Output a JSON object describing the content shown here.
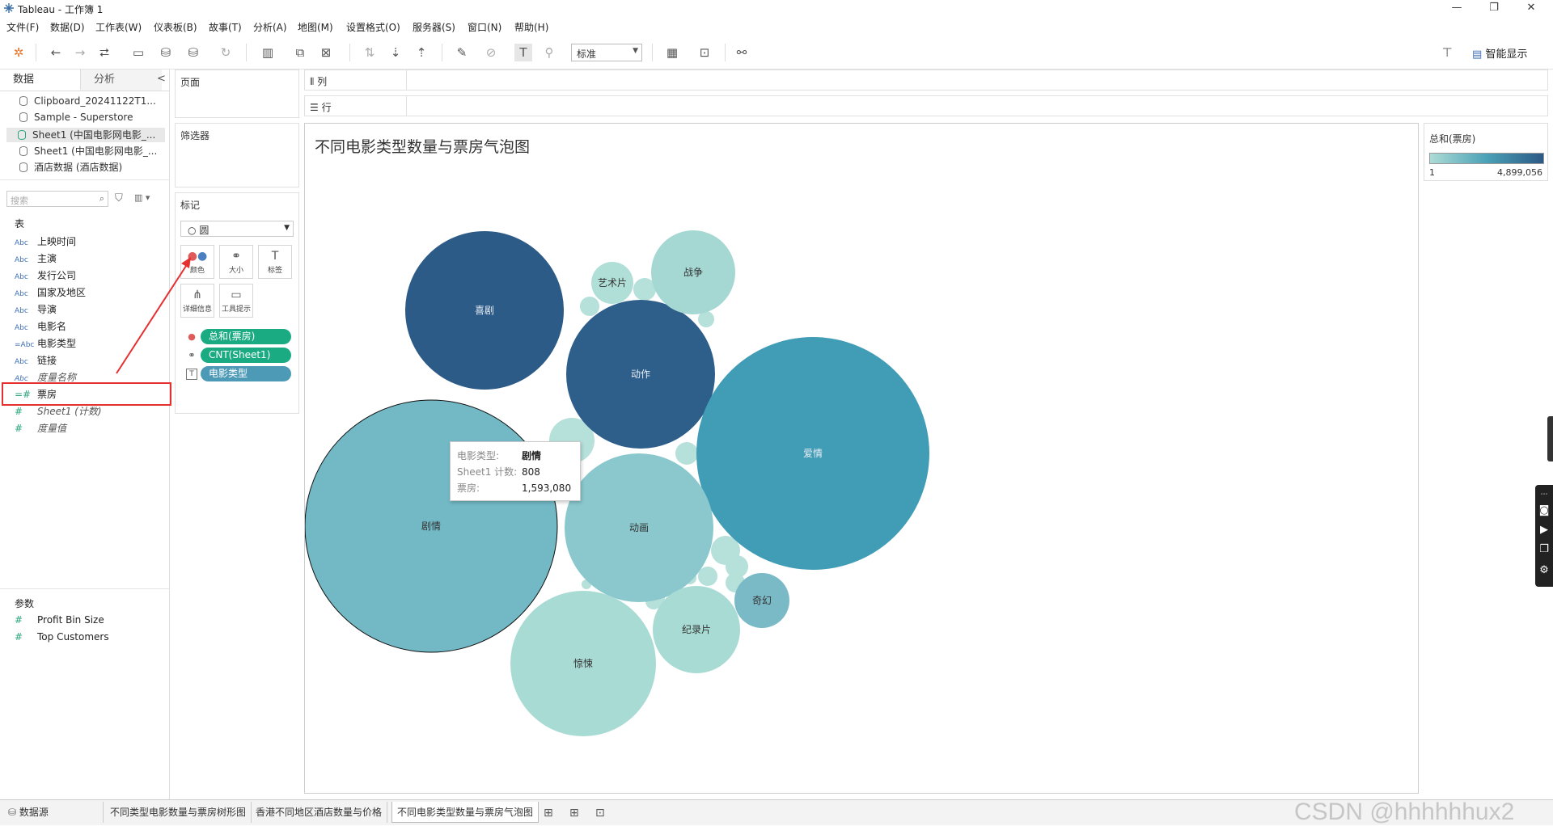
{
  "window": {
    "title": "Tableau - 工作簿 1",
    "min": "—",
    "max": "❐",
    "close": "✕"
  },
  "menu": [
    "文件(F)",
    "数据(D)",
    "工作表(W)",
    "仪表板(B)",
    "故事(T)",
    "分析(A)",
    "地图(M)",
    "设置格式(O)",
    "服务器(S)",
    "窗口(N)",
    "帮助(H)"
  ],
  "toolbar": {
    "fit": "标准",
    "smart_show": "智能显示"
  },
  "data_pane": {
    "tabs": [
      "数据",
      "分析"
    ],
    "collapse": "<",
    "sources": [
      "Clipboard_20241122T1...",
      "Sample - Superstore",
      "Sheet1 (中国电影网电影_...",
      "Sheet1 (中国电影网电影_...",
      "酒店数据 (酒店数据)"
    ],
    "search_placeholder": "搜索",
    "tables_label": "表",
    "dimensions": [
      {
        "type": "Abc",
        "name": "上映时间"
      },
      {
        "type": "Abc",
        "name": "主演"
      },
      {
        "type": "Abc",
        "name": "发行公司"
      },
      {
        "type": "Abc",
        "name": "国家及地区"
      },
      {
        "type": "Abc",
        "name": "导演"
      },
      {
        "type": "Abc",
        "name": "电影名"
      },
      {
        "type": "=Abc",
        "name": "电影类型"
      },
      {
        "type": "Abc",
        "name": "链接"
      },
      {
        "type": "Abc",
        "name": "度量名称"
      }
    ],
    "measures": [
      {
        "type": "=#",
        "name": "票房"
      },
      {
        "type": "#",
        "name": "Sheet1 (计数)"
      },
      {
        "type": "#",
        "name": "度量值"
      }
    ],
    "params_label": "参数",
    "params": [
      "Profit Bin Size",
      "Top Customers"
    ]
  },
  "cards": {
    "pages": "页面",
    "filters": "筛选器",
    "marks": "标记",
    "mark_type": "圆",
    "mark_buttons": [
      "颜色",
      "大小",
      "标签",
      "详细信息",
      "工具提示"
    ],
    "pills": [
      {
        "icon": "color-icon",
        "text": "总和(票房)",
        "color": "#1bab83"
      },
      {
        "icon": "size-icon",
        "text": "CNT(Sheet1)",
        "color": "#1bab83"
      },
      {
        "icon": "label-icon",
        "text": "电影类型",
        "color": "#4d9ab7"
      }
    ]
  },
  "shelves": {
    "columns": "列",
    "rows": "行"
  },
  "view": {
    "title": "不同电影类型数量与票房气泡图"
  },
  "chart_data": {
    "type": "bubble",
    "title": "不同电影类型数量与票房气泡图",
    "color_measure": "总和(票房)",
    "size_measure": "CNT(Sheet1)",
    "label_field": "电影类型",
    "bubbles": [
      {
        "label": "喜剧",
        "color": "#2d5b87"
      },
      {
        "label": "动作",
        "color": "#2e5e8a"
      },
      {
        "label": "爱情",
        "color": "#419cb5"
      },
      {
        "label": "剧情",
        "color": "#72b8c5",
        "count": 808,
        "box_office": 1593080
      },
      {
        "label": "动画",
        "color": "#8ac8cd"
      },
      {
        "label": "惊悚",
        "color": "#a9dbd5"
      },
      {
        "label": "战争",
        "color": "#a5d8d3"
      },
      {
        "label": "纪录片",
        "color": "#a8dbd4"
      },
      {
        "label": "奇幻",
        "color": "#7ab9c6"
      },
      {
        "label": "艺术片",
        "color": "#b0dfd7"
      }
    ]
  },
  "tooltip": {
    "rows": [
      {
        "key": "电影类型:",
        "value": "剧情"
      },
      {
        "key": "Sheet1 计数:",
        "value": "808"
      },
      {
        "key": "票房:",
        "value": "1,593,080"
      }
    ]
  },
  "legend": {
    "title": "总和(票房)",
    "min": "1",
    "max": "4,899,056"
  },
  "bottom_tabs": [
    "数据源",
    "不同类型电影数量与票房树形图",
    "香港不同地区酒店数量与价格",
    "不同电影类型数量与票房气泡图"
  ],
  "watermark": "CSDN @hhhhhhux2"
}
